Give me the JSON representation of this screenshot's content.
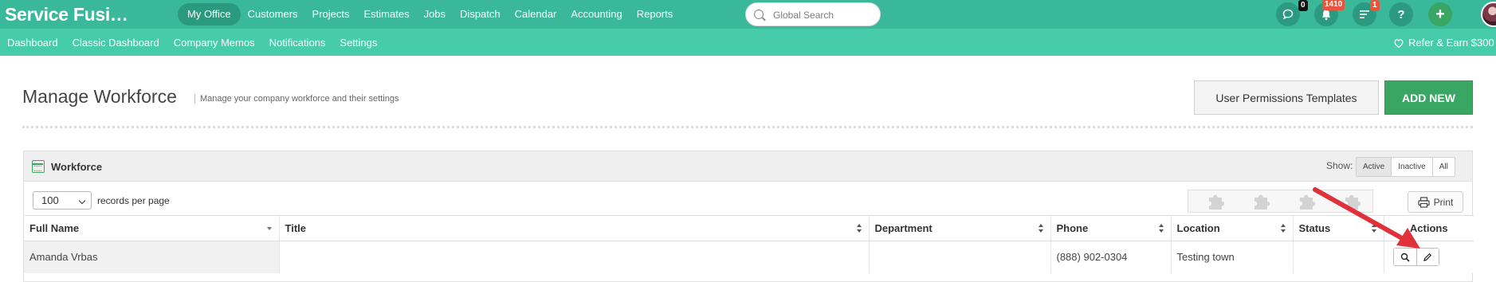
{
  "app": {
    "brand": "Service Fusi…"
  },
  "top_nav": {
    "items": [
      {
        "label": "My Office"
      },
      {
        "label": "Customers"
      },
      {
        "label": "Projects"
      },
      {
        "label": "Estimates"
      },
      {
        "label": "Jobs"
      },
      {
        "label": "Dispatch"
      },
      {
        "label": "Calendar"
      },
      {
        "label": "Accounting"
      },
      {
        "label": "Reports"
      }
    ],
    "search_placeholder": "Global Search",
    "chat_badge": "0",
    "notification_badge": "1410",
    "tasks_badge": "1",
    "help_label": "?",
    "add_label": "+"
  },
  "sub_nav": {
    "items": [
      {
        "label": "Dashboard"
      },
      {
        "label": "Classic Dashboard"
      },
      {
        "label": "Company Memos"
      },
      {
        "label": "Notifications"
      },
      {
        "label": "Settings"
      }
    ],
    "refer_label": "Refer & Earn $300"
  },
  "header": {
    "title": "Manage Workforce",
    "subtitle": "Manage your company workforce and their settings",
    "permissions_button": "User Permissions Templates",
    "add_button": "ADD NEW"
  },
  "panel": {
    "title": "Workforce",
    "show_label": "Show:",
    "show_options": [
      "Active",
      "Inactive",
      "All"
    ],
    "show_selected": "Active",
    "records_per_page_value": "100",
    "records_per_page_label": "records per page",
    "print_label": "Print",
    "columns": [
      "Full Name",
      "Title",
      "Department",
      "Phone",
      "Location",
      "Status",
      "Actions"
    ],
    "rows": [
      {
        "full_name": "Amanda Vrbas",
        "title": "",
        "department": "",
        "phone": "(888) 902-0304",
        "location": "Testing town",
        "status": ""
      }
    ]
  },
  "colors": {
    "topbar": "#39b89a",
    "subbar": "#47ccaa",
    "badge_red": "#e8553e",
    "add_green": "#3aa664",
    "annotation_arrow": "#e0303a"
  }
}
